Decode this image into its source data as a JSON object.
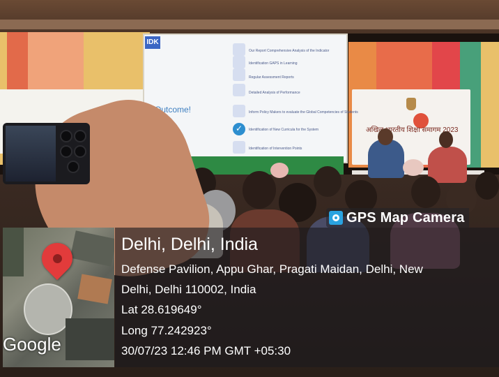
{
  "stage": {
    "screen_logo": "IDK",
    "slide_heading": "Outcome!",
    "slide_items": [
      "Our Report Comprehensive  Analysis of the Indicator",
      "Identification GAPS in Learning",
      "Regular Assessment Reports",
      "Detailed Analysis of Performance",
      "Inform Policy Makers to evaluate the Global Competencies of Students",
      "Identification of New Curricula for the System",
      "Identification of Intervention Points"
    ],
    "banner_caption": "अखिल भारतीय शिक्षा समागम 2023"
  },
  "gps": {
    "brand": "GPS Map Camera",
    "city": "Delhi, Delhi, India",
    "address_line1": "Defense Pavilion, Appu Ghar, Pragati Maidan, Delhi, New",
    "address_line2": "Delhi, Delhi 110002, India",
    "lat": "Lat 28.619649°",
    "long": "Long 77.242923°",
    "datetime": "30/07/23 12:46 PM GMT +05:30",
    "map_label": "Google"
  },
  "colors": {
    "pin": "#e23b3b",
    "overlay": "#1c1a1e",
    "slide_accent": "#3e7fc0",
    "stage_green": "#2e8a44"
  }
}
